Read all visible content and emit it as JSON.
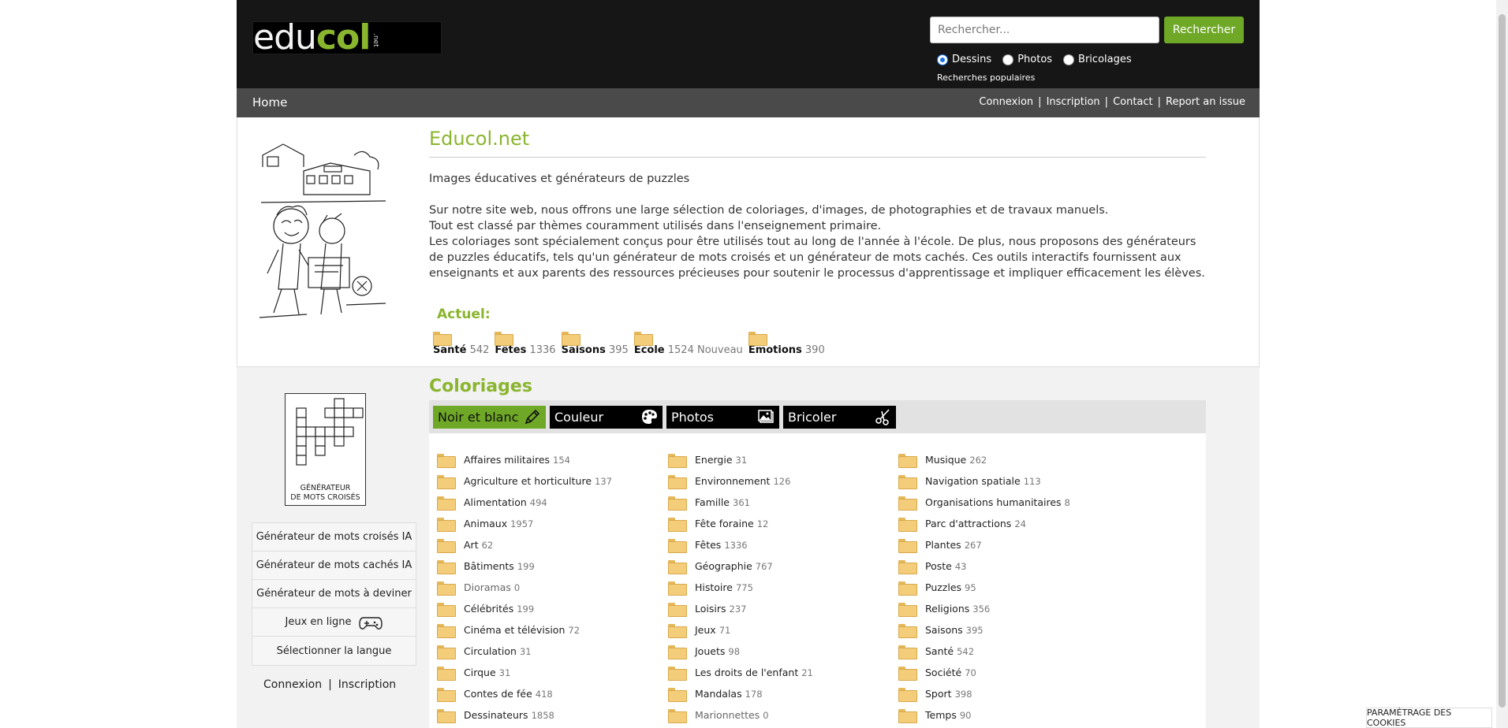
{
  "header": {
    "logo": {
      "edu": "edu",
      "col": "col",
      "net": ".net"
    },
    "search": {
      "placeholder": "Rechercher...",
      "button": "Rechercher"
    },
    "radios": [
      {
        "label": "Dessins",
        "checked": true
      },
      {
        "label": "Photos",
        "checked": false
      },
      {
        "label": "Bricolages",
        "checked": false
      }
    ],
    "popular": "Recherches populaires"
  },
  "nav": {
    "home": "Home",
    "links": [
      "Connexion",
      "Inscription",
      "Contact",
      "Report an issue"
    ]
  },
  "intro": {
    "title": "Educol.net",
    "tagline": "Images éducatives et générateurs de puzzles",
    "lines": [
      "Sur notre site web, nous offrons une large sélection de coloriages, d'images, de photographies et de travaux manuels.",
      "Tout est classé par thèmes couramment utilisés dans l'enseignement primaire.",
      "Les coloriages sont spécialement conçus pour être utilisés tout au long de l'année à l'école. De plus, nous proposons des générateurs de puzzles éducatifs, tels qu'un générateur de mots croisés et un générateur de mots cachés. Ces outils interactifs fournissent aux enseignants et aux parents des ressources précieuses pour soutenir le processus d'apprentissage et impliquer efficacement les élèves."
    ],
    "actuel_title": "Actuel:",
    "actuel": [
      {
        "name": "Santé",
        "count": "542",
        "tag": ""
      },
      {
        "name": "Fêtes",
        "count": "1336",
        "tag": ""
      },
      {
        "name": "Saisons",
        "count": "395",
        "tag": ""
      },
      {
        "name": "Ecole",
        "count": "1524",
        "tag": "Nouveau"
      },
      {
        "name": "Emotions",
        "count": "390",
        "tag": ""
      }
    ]
  },
  "sidebar": {
    "image_label": [
      "GÉNÉRATEUR",
      "DE MOTS CROISÉS"
    ],
    "menu": [
      "Générateur de mots croisés IA",
      "Générateur de mots cachés IA",
      "Générateur de mots à deviner",
      "Jeux en ligne",
      "Sélectionner la langue"
    ],
    "auth": {
      "login": "Connexion",
      "sep": "|",
      "register": "Inscription"
    }
  },
  "coloriages": {
    "title": "Coloriages",
    "tabs": [
      {
        "label": "Noir et blanc",
        "icon": "pencil-icon",
        "active": true
      },
      {
        "label": "Couleur",
        "icon": "palette-icon",
        "active": false
      },
      {
        "label": "Photos",
        "icon": "photo-icon",
        "active": false
      },
      {
        "label": "Bricoler",
        "icon": "scissors-icon",
        "active": false
      }
    ],
    "columns": [
      [
        {
          "name": "Affaires militaires",
          "count": "154"
        },
        {
          "name": "Agriculture et horticulture",
          "count": "137"
        },
        {
          "name": "Alimentation",
          "count": "494"
        },
        {
          "name": "Animaux",
          "count": "1957"
        },
        {
          "name": "Art",
          "count": "62"
        },
        {
          "name": "Bâtiments",
          "count": "199"
        },
        {
          "name": "Dioramas",
          "count": "0"
        },
        {
          "name": "Célébrités",
          "count": "199"
        },
        {
          "name": "Cinéma et télévision",
          "count": "72"
        },
        {
          "name": "Circulation",
          "count": "31"
        },
        {
          "name": "Cirque",
          "count": "31"
        },
        {
          "name": "Contes de fée",
          "count": "418"
        },
        {
          "name": "Dessinateurs",
          "count": "1858"
        }
      ],
      [
        {
          "name": "Energie",
          "count": "31"
        },
        {
          "name": "Environnement",
          "count": "126"
        },
        {
          "name": "Famille",
          "count": "361"
        },
        {
          "name": "Fête foraine",
          "count": "12"
        },
        {
          "name": "Fêtes",
          "count": "1336"
        },
        {
          "name": "Géographie",
          "count": "767"
        },
        {
          "name": "Histoire",
          "count": "775"
        },
        {
          "name": "Loisirs",
          "count": "237"
        },
        {
          "name": "Jeux",
          "count": "71"
        },
        {
          "name": "Jouets",
          "count": "98"
        },
        {
          "name": "Les droits de l'enfant",
          "count": "21"
        },
        {
          "name": "Mandalas",
          "count": "178"
        },
        {
          "name": "Marionnettes",
          "count": "0"
        }
      ],
      [
        {
          "name": "Musique",
          "count": "262"
        },
        {
          "name": "Navigation spatiale",
          "count": "113"
        },
        {
          "name": "Organisations humanitaires",
          "count": "8"
        },
        {
          "name": "Parc d'attractions",
          "count": "24"
        },
        {
          "name": "Plantes",
          "count": "267"
        },
        {
          "name": "Poste",
          "count": "43"
        },
        {
          "name": "Puzzles",
          "count": "95"
        },
        {
          "name": "Religions",
          "count": "356"
        },
        {
          "name": "Saisons",
          "count": "395"
        },
        {
          "name": "Santé",
          "count": "542"
        },
        {
          "name": "Société",
          "count": "70"
        },
        {
          "name": "Sport",
          "count": "398"
        },
        {
          "name": "Temps",
          "count": "90"
        }
      ]
    ]
  },
  "cookie": "PARAMÉTRAGE DES COOKIES",
  "colors": {
    "accent": "#8ab52e",
    "button": "#6fa826",
    "header": "#161616",
    "nav": "#4a4a4a"
  }
}
